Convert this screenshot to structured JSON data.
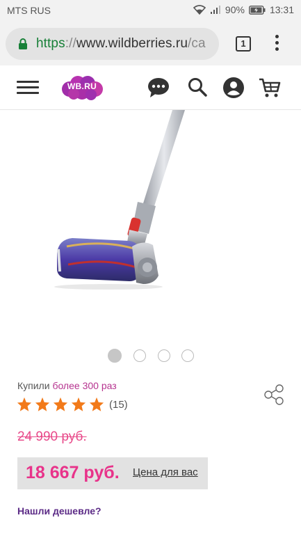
{
  "status_bar": {
    "carrier": "MTS RUS",
    "battery": "90%",
    "time": "13:31"
  },
  "browser": {
    "url_scheme": "https",
    "url_sep": "://",
    "url_host": "www.wildberries.ru",
    "url_path": "/ca",
    "tab_count": "1"
  },
  "header": {
    "logo_text": "WB.RU",
    "brand_color": "#9b2fae",
    "icons": [
      "menu-icon",
      "chat-icon",
      "search-icon",
      "user-icon",
      "cart-icon"
    ]
  },
  "product": {
    "image_icon": "vacuum-cleaner",
    "carousel": {
      "count": 4,
      "active": 1
    },
    "bought_prefix": "Купили",
    "bought_count": "более 300 раз",
    "rating": {
      "stars": 5,
      "reviews": "(15)"
    },
    "old_price": "24 990 руб.",
    "price": "18 667 руб.",
    "price_note": "Цена для вас",
    "found_cheaper": "Нашли дешевле?",
    "accent_pink": "#e8338a",
    "star_color": "#f27a1a"
  }
}
